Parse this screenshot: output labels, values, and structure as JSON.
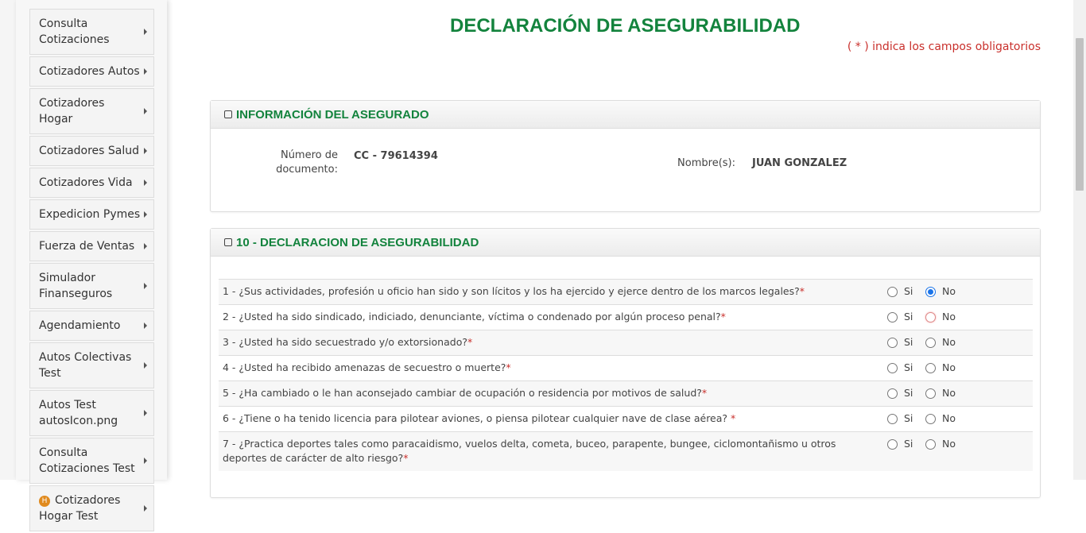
{
  "sidebar": {
    "items": [
      {
        "label": "Consulta Cotizaciones"
      },
      {
        "label": "Cotizadores Autos"
      },
      {
        "label": "Cotizadores Hogar"
      },
      {
        "label": "Cotizadores Salud"
      },
      {
        "label": "Cotizadores Vida"
      },
      {
        "label": "Expedicion Pymes"
      },
      {
        "label": "Fuerza de Ventas"
      },
      {
        "label": "Simulador Finanseguros"
      },
      {
        "label": "Agendamiento"
      },
      {
        "label": "Autos Colectivas Test"
      },
      {
        "label": "Autos Test autosIcon.png"
      },
      {
        "label": "Consulta Cotizaciones Test"
      },
      {
        "label": "Cotizadores Hogar Test",
        "icon": "H"
      }
    ]
  },
  "page": {
    "title": "DECLARACIÓN DE ASEGURABILIDAD",
    "required_note": "( * ) indica los campos obligatorios"
  },
  "insured": {
    "header": "INFORMACIÓN DEL ASEGURADO",
    "doc_label": "Número de documento:",
    "doc_value": "CC - 79614394",
    "name_label": "Nombre(s):",
    "name_value": "JUAN GONZALEZ"
  },
  "declaration": {
    "header": "10 - DECLARACION DE ASEGURABILIDAD",
    "yes_label": "Si",
    "no_label": "No",
    "questions": [
      {
        "text": "1 - ¿Sus actividades, profesión u oficio han sido y son lícitos y los ha ejercido y ejerce dentro de los marcos legales?",
        "answer": "No"
      },
      {
        "text": "2 - ¿Usted ha sido sindicado, indiciado, denunciante, víctima o condenado por algún proceso penal?",
        "answer": null
      },
      {
        "text": "3 - ¿Usted ha sido secuestrado y/o extorsionado?",
        "answer": null
      },
      {
        "text": "4 - ¿Usted ha recibido amenazas de secuestro o muerte?",
        "answer": null
      },
      {
        "text": "5 - ¿Ha cambiado o le han aconsejado cambiar de ocupación o residencia por motivos de salud?",
        "answer": null
      },
      {
        "text": "6 - ¿Tiene o ha tenido licencia para pilotear aviones, o piensa pilotear cualquier nave de clase aérea? ",
        "answer": null
      },
      {
        "text": "7 - ¿Practica deportes tales como paracaidismo, vuelos delta, cometa, buceo, parapente, bungee, ciclomontañismo u otros deportes de carácter de alto riesgo?",
        "answer": null
      }
    ],
    "required_mark": "*"
  }
}
